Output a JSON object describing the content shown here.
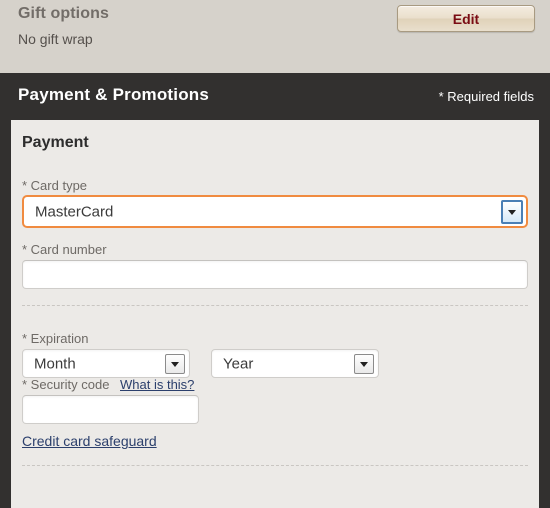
{
  "gift_options": {
    "title": "Gift options",
    "status": "No gift wrap",
    "edit_label": "Edit"
  },
  "payment_section": {
    "header_title": "Payment & Promotions",
    "required_note": "* Required fields",
    "panel_heading": "Payment",
    "fields": {
      "card_type": {
        "label": "* Card type",
        "value": "MasterCard",
        "focused": true
      },
      "card_number": {
        "label": "* Card number",
        "value": "",
        "placeholder": ""
      },
      "expiration": {
        "label": "* Expiration",
        "month": {
          "value": "Month"
        },
        "year": {
          "value": "Year"
        }
      },
      "security_code": {
        "label": "* Security code",
        "help_link": "What is this?",
        "value": "",
        "placeholder": ""
      }
    },
    "safeguard_link": "Credit card safeguard"
  },
  "colors": {
    "page_background": "#d6d2cb",
    "section_dark": "#32302f",
    "panel_background": "#eceae7",
    "focus_orange": "#f08b40",
    "link_blue": "#2b3f6c",
    "edit_text": "#7a0c14"
  }
}
